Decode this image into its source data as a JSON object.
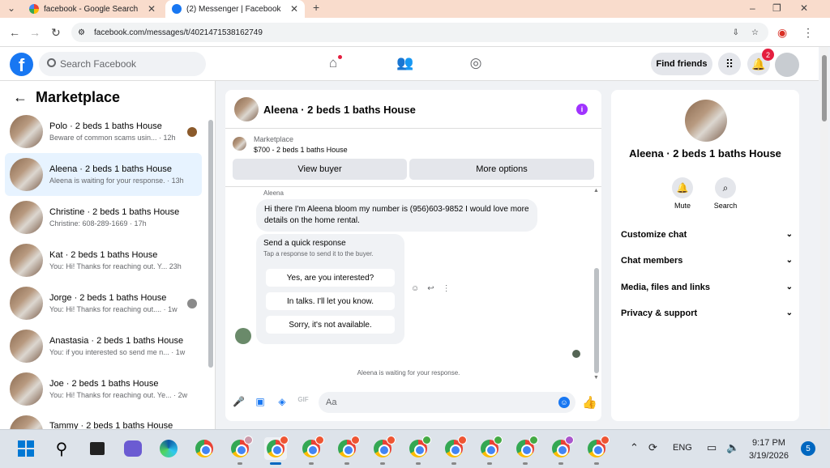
{
  "browser": {
    "tabs": [
      {
        "label": "facebook - Google Search"
      },
      {
        "label": "(2) Messenger | Facebook"
      }
    ],
    "url": "facebook.com/messages/t/4021471538162749"
  },
  "fb": {
    "search_placeholder": "Search Facebook",
    "find_friends": "Find friends",
    "notif_count": "2"
  },
  "left": {
    "title": "Marketplace",
    "convs": [
      {
        "name": "Polo · 2 beds 1 baths House",
        "preview": "Beware of common scams usin... · 12h"
      },
      {
        "name": "Aleena · 2 beds 1 baths House",
        "preview": "Aleena is waiting for your response. · 13h"
      },
      {
        "name": "Christine · 2 beds 1 baths House",
        "preview": "Christine: 608-289-1669 · 17h"
      },
      {
        "name": "Kat · 2 beds 1 baths House",
        "preview": "You: Hi! Thanks for reaching out. Y...   23h"
      },
      {
        "name": "Jorge · 2 beds 1 baths House",
        "preview": "You: Hi! Thanks for reaching out.... · 1w"
      },
      {
        "name": "Anastasia · 2 beds 1 baths House",
        "preview": "You: if you interested so send me n... · 1w"
      },
      {
        "name": "Joe · 2 beds 1 baths House",
        "preview": "You: Hi! Thanks for reaching out. Ye... · 2w"
      },
      {
        "name": "Tammy · 2 beds 1 baths House",
        "preview": ""
      }
    ]
  },
  "chat": {
    "title": "Aleena · 2 beds 1 baths House",
    "marketplace_label": "Marketplace",
    "listing": "$700 - 2 beds 1 baths House",
    "view_buyer": "View buyer",
    "more_options": "More options",
    "sender": "Aleena",
    "message": "Hi there I'm Aleena bloom my number is (956)603-9852 I would love more details on the home rental.",
    "quick_title": "Send a quick response",
    "quick_sub": "Tap a response to send it to the buyer.",
    "quick_responses": [
      "Yes, are you interested?",
      "In talks. I'll let you know.",
      "Sorry, it's not available."
    ],
    "waiting": "Aleena is waiting for your response.",
    "input_placeholder": "Aa"
  },
  "right": {
    "name": "Aleena · 2 beds 1 baths House",
    "mute": "Mute",
    "search": "Search",
    "sections": [
      "Customize chat",
      "Chat members",
      "Media, files and links",
      "Privacy & support"
    ]
  },
  "taskbar": {
    "lang": "ENG",
    "time": "9:17 PM",
    "date": "3/19/2026",
    "notifications": "5"
  }
}
